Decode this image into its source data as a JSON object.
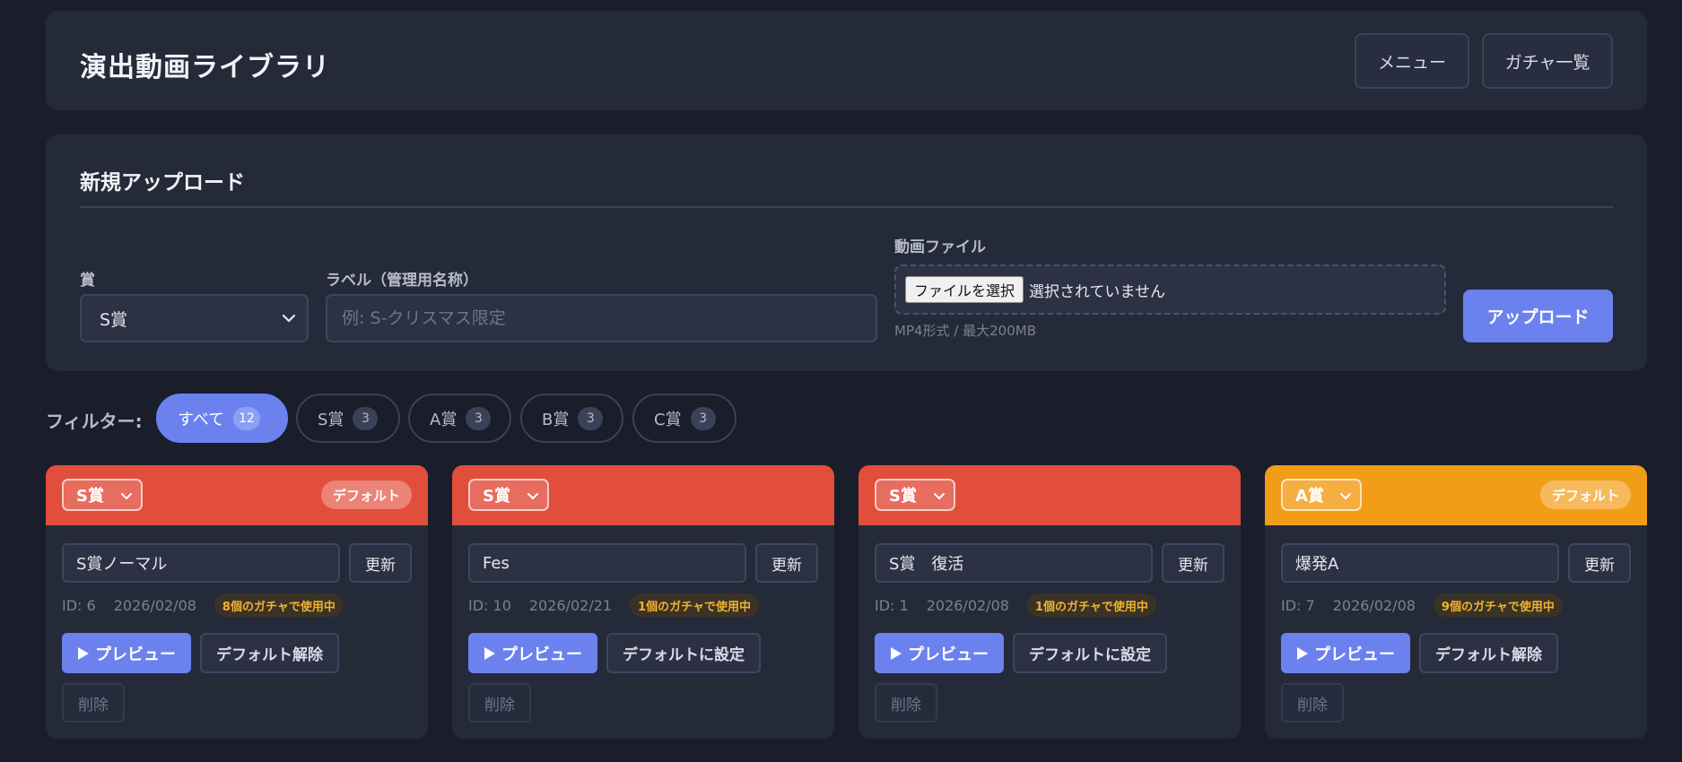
{
  "header": {
    "title": "演出動画ライブラリ",
    "menu_label": "メニュー",
    "gacha_list_label": "ガチャ一覧"
  },
  "upload": {
    "title": "新規アップロード",
    "prize_label": "賞",
    "prize_value": "S賞",
    "label_label": "ラベル（管理用名称）",
    "label_placeholder": "例: S-クリスマス限定",
    "file_label": "動画ファイル",
    "file_button": "ファイルを選択",
    "file_status": "選択されていません",
    "file_hint": "MP4形式 / 最大200MB",
    "upload_button": "アップロード"
  },
  "filter": {
    "label": "フィルター:",
    "chips": [
      {
        "label": "すべて",
        "count": "12",
        "active": true
      },
      {
        "label": "S賞",
        "count": "3",
        "active": false
      },
      {
        "label": "A賞",
        "count": "3",
        "active": false
      },
      {
        "label": "B賞",
        "count": "3",
        "active": false
      },
      {
        "label": "C賞",
        "count": "3",
        "active": false
      }
    ]
  },
  "cards": [
    {
      "prize": "S賞",
      "band_color": "#e24e3c",
      "default_badge": "デフォルト",
      "name": "S賞ノーマル",
      "update": "更新",
      "id": "ID: 6",
      "date": "2026/02/08",
      "usage": "8個のガチャで使用中",
      "preview": "プレビュー",
      "default_action": "デフォルト解除",
      "delete": "削除"
    },
    {
      "prize": "S賞",
      "band_color": "#e24e3c",
      "default_badge": "",
      "name": "Fes",
      "update": "更新",
      "id": "ID: 10",
      "date": "2026/02/21",
      "usage": "1個のガチャで使用中",
      "preview": "プレビュー",
      "default_action": "デフォルトに設定",
      "delete": "削除"
    },
    {
      "prize": "S賞",
      "band_color": "#e24e3c",
      "default_badge": "",
      "name": "S賞　復活",
      "update": "更新",
      "id": "ID: 1",
      "date": "2026/02/08",
      "usage": "1個のガチャで使用中",
      "preview": "プレビュー",
      "default_action": "デフォルトに設定",
      "delete": "削除"
    },
    {
      "prize": "A賞",
      "band_color": "#f29d18",
      "default_badge": "デフォルト",
      "name": "爆発A",
      "update": "更新",
      "id": "ID: 7",
      "date": "2026/02/08",
      "usage": "9個のガチャで使用中",
      "preview": "プレビュー",
      "default_action": "デフォルト解除",
      "delete": "削除"
    }
  ],
  "colors": {
    "accent": "#6b82ee",
    "s_prize": "#e24e3c",
    "a_prize": "#f29d18",
    "usage_text": "#f2b230"
  }
}
